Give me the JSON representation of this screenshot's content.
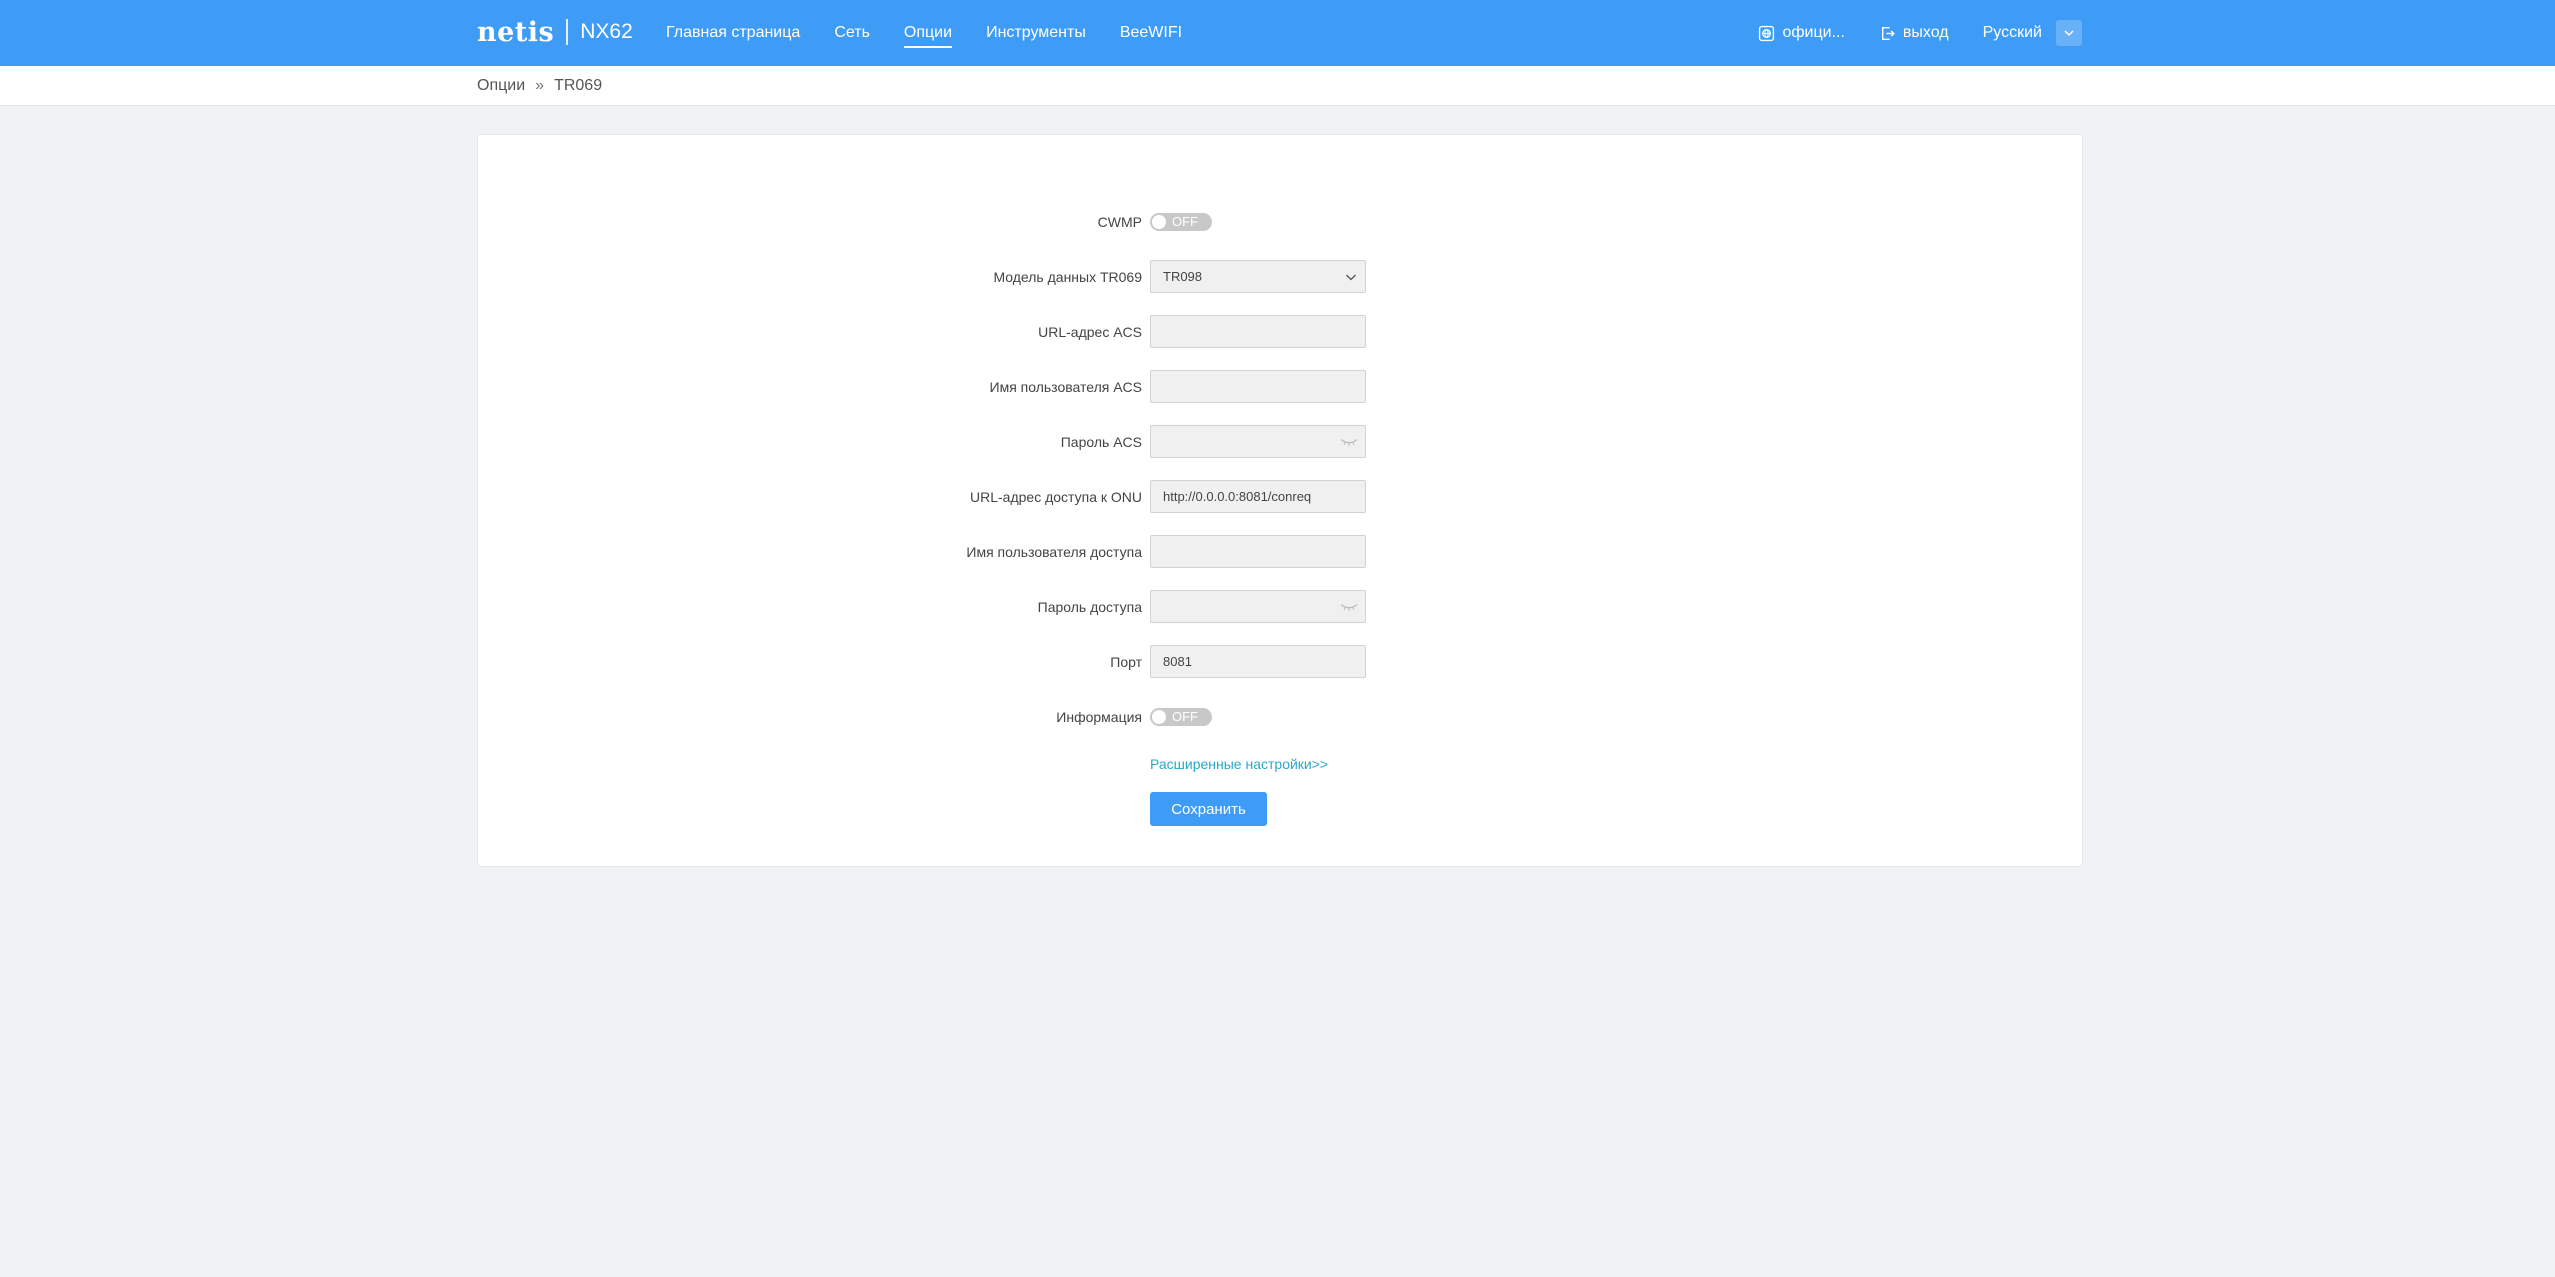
{
  "header": {
    "brand": "netis",
    "model": "NX62",
    "nav": [
      {
        "label": "Главная страница"
      },
      {
        "label": "Сеть"
      },
      {
        "label": "Опции"
      },
      {
        "label": "Инструменты"
      },
      {
        "label": "BeeWIFI"
      }
    ],
    "active_nav": "Опции",
    "official_label": "офици...",
    "logout_label": "выход",
    "language": "Русский",
    "accent_color": "#3e9cf7"
  },
  "breadcrumb": {
    "parent": "Опции",
    "separator": "»",
    "current": "TR069"
  },
  "form": {
    "cwmp": {
      "label": "CWMP",
      "state": "OFF"
    },
    "data_model": {
      "label": "Модель данных TR069",
      "value": "TR098"
    },
    "acs_url": {
      "label": "URL-адрес ACS",
      "value": ""
    },
    "acs_user": {
      "label": "Имя пользователя ACS",
      "value": ""
    },
    "acs_password": {
      "label": "Пароль ACS",
      "value": ""
    },
    "onu_url": {
      "label": "URL-адрес доступа к ONU",
      "value": "http://0.0.0.0:8081/conreq"
    },
    "access_user": {
      "label": "Имя пользователя доступа",
      "value": ""
    },
    "access_password": {
      "label": "Пароль доступа",
      "value": ""
    },
    "port": {
      "label": "Порт",
      "value": "8081"
    },
    "inform": {
      "label": "Информация",
      "state": "OFF"
    },
    "advanced_link": "Расширенные настройки>>",
    "save_label": "Сохранить"
  }
}
